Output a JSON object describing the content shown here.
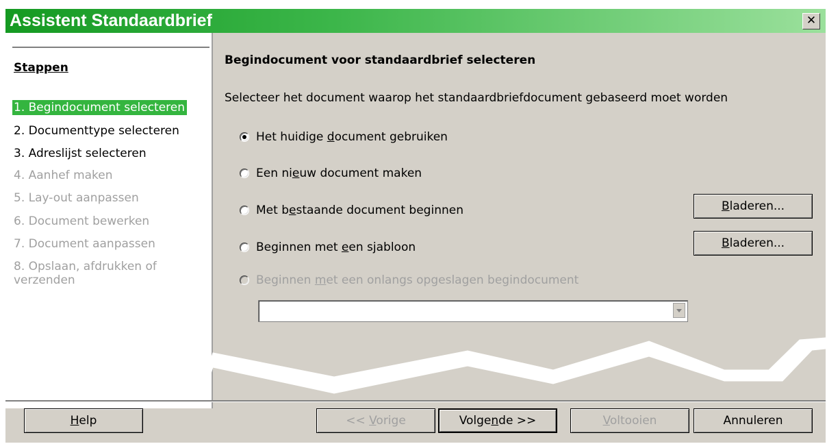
{
  "window": {
    "title": "Assistent Standaardbrief",
    "close_glyph": "✕"
  },
  "steps": {
    "header": "Stappen",
    "items": [
      {
        "label": "1. Begindocument selecteren",
        "state": "active"
      },
      {
        "label": "2. Documenttype selecteren",
        "state": "enabled"
      },
      {
        "label": "3. Adreslijst selecteren",
        "state": "enabled"
      },
      {
        "label": "4. Aanhef maken",
        "state": "disabled"
      },
      {
        "label": "5. Lay-out aanpassen",
        "state": "disabled"
      },
      {
        "label": "6. Document bewerken",
        "state": "disabled"
      },
      {
        "label": "7. Document aanpassen",
        "state": "disabled"
      },
      {
        "label": "8. Opslaan, afdrukken of verzenden",
        "state": "disabled"
      }
    ]
  },
  "main": {
    "heading": "Begindocument voor standaardbrief selecteren",
    "description": "Selecteer het document waarop het standaardbriefdocument gebaseerd moet worden",
    "options": [
      {
        "pre": "Het huidige ",
        "acc": "d",
        "post": "ocument gebruiken",
        "checked": true,
        "enabled": true
      },
      {
        "pre": "Een ni",
        "acc": "e",
        "post": "uw document maken",
        "checked": false,
        "enabled": true
      },
      {
        "pre": "Met b",
        "acc": "e",
        "post": "staande document beginnen",
        "checked": false,
        "enabled": true
      },
      {
        "pre": "Beginnen met ",
        "acc": "e",
        "post": "en sjabloon",
        "checked": false,
        "enabled": true
      },
      {
        "pre": "Beginnen ",
        "acc": "m",
        "post": "et een onlangs opgeslagen begindocument",
        "checked": false,
        "enabled": false
      }
    ],
    "browse_button_1": {
      "acc": "B",
      "rest": "laderen..."
    },
    "browse_button_2": {
      "acc": "B",
      "rest": "laderen..."
    },
    "recent_combo_value": ""
  },
  "footer": {
    "help": {
      "acc": "H",
      "rest": "elp"
    },
    "prev": {
      "pre": "<< ",
      "acc": "V",
      "post": "orige"
    },
    "next": {
      "pre": "Volge",
      "acc": "n",
      "post": "de >>"
    },
    "finish": {
      "acc": "V",
      "rest": "oltooien"
    },
    "cancel": "Annuleren"
  }
}
